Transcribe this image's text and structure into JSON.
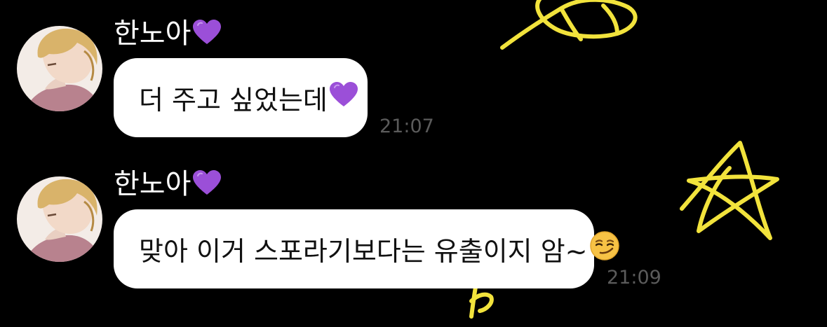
{
  "colors": {
    "background": "#000000",
    "bubble": "#ffffff",
    "bubble_text": "#111111",
    "sender_text": "#ffffff",
    "timestamp": "#5b5b5b",
    "doodle_stroke": "#f2e33c",
    "heart": "#9b4fd8"
  },
  "messages": [
    {
      "sender": "한노아",
      "sender_emoji": "purple-heart",
      "text": "더 주고 싶었는데",
      "text_emoji": "purple-heart",
      "time": "21:07"
    },
    {
      "sender": "한노아",
      "sender_emoji": "purple-heart",
      "text": "맞아 이거 스포라기보다는 유출이지 암~",
      "text_emoji": "smirking-face",
      "time": "21:09"
    }
  ]
}
